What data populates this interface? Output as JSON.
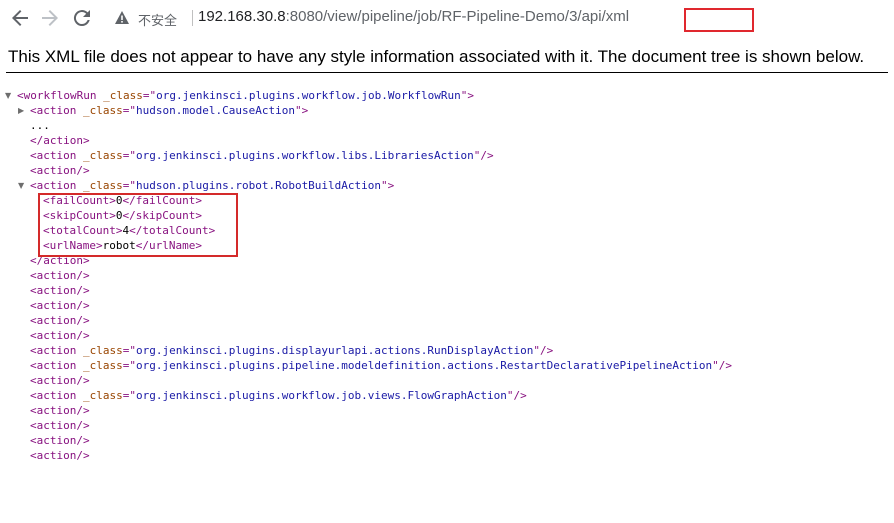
{
  "browser": {
    "security_label": "不安全",
    "url_host": "192.168.30.8",
    "url_port_path": ":8080/view/pipeline/job/RF-Pipeline-Demo/3",
    "url_suffix": "/api/xml"
  },
  "banner": {
    "text": "This XML file does not appear to have any style information associated with it. The document tree is shown below."
  },
  "xml": {
    "root_open": {
      "tag": "workflowRun",
      "attr": "_class",
      "val": "org.jenkinsci.plugins.workflow.job.WorkflowRun"
    },
    "a1_open": {
      "tag": "action",
      "attr": "_class",
      "val": "hudson.model.CauseAction"
    },
    "ellipsis": "...",
    "a1_close": "</action>",
    "a2": {
      "tag": "action",
      "attr": "_class",
      "val": "org.jenkinsci.plugins.workflow.libs.LibrariesAction"
    },
    "empty_action": "<action/>",
    "a3_open": {
      "tag": "action",
      "attr": "_class",
      "val": "hudson.plugins.robot.RobotBuildAction"
    },
    "fields": [
      {
        "tag": "failCount",
        "value": "0"
      },
      {
        "tag": "skipCount",
        "value": "0"
      },
      {
        "tag": "totalCount",
        "value": "4"
      },
      {
        "tag": "urlName",
        "value": "robot"
      }
    ],
    "a3_close": "</action>",
    "a4": {
      "tag": "action",
      "attr": "_class",
      "val": "org.jenkinsci.plugins.displayurlapi.actions.RunDisplayAction"
    },
    "a5": {
      "tag": "action",
      "attr": "_class",
      "val": "org.jenkinsci.plugins.pipeline.modeldefinition.actions.RestartDeclarativePipelineAction"
    },
    "a6": {
      "tag": "action",
      "attr": "_class",
      "val": "org.jenkinsci.plugins.workflow.job.views.FlowGraphAction"
    }
  },
  "colors": {
    "tag": "#881280",
    "attr_name": "#994500",
    "attr_value": "#1a1aa6",
    "highlight": "#e0282e"
  }
}
